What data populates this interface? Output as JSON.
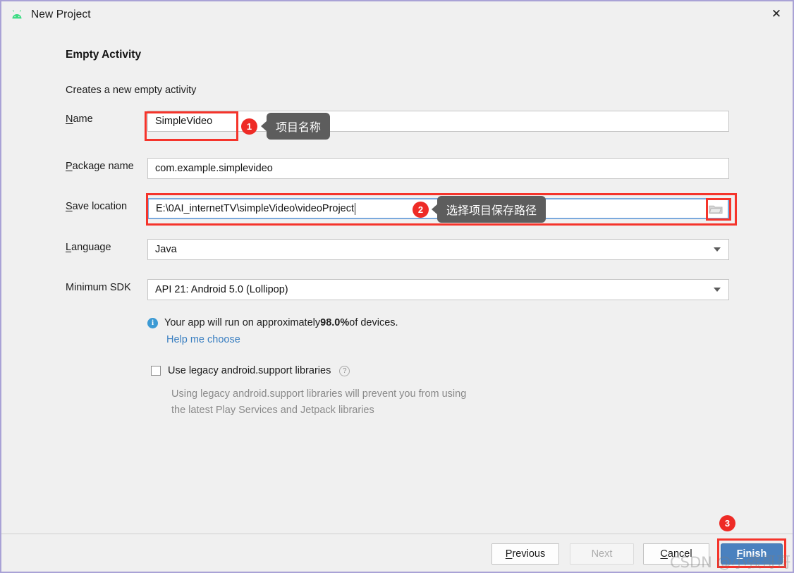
{
  "window": {
    "title": "New Project",
    "app_icon": "android-robot-icon",
    "close_icon": "close-icon",
    "border_color": "#a9a2d6",
    "background": "#f0f0f0"
  },
  "wizard": {
    "heading": "Empty Activity",
    "subheading": "Creates a new empty activity"
  },
  "fields": [
    {
      "label": "Name",
      "mnemonic": "N",
      "rest": "ame",
      "value": "SimpleVideo",
      "type": "text"
    },
    {
      "label": "Package name",
      "mnemonic": "P",
      "rest": "ackage name",
      "value": "com.example.simplevideo",
      "type": "text"
    },
    {
      "label": "Save location",
      "mnemonic": "S",
      "rest": "ave location",
      "value": "E:\\0AI_internetTV\\simpleVideo\\videoProject",
      "type": "text-with-browse",
      "browse_icon": "folder-icon",
      "focused": true
    },
    {
      "label": "Language",
      "mnemonic": "L",
      "rest": "anguage",
      "value": "Java",
      "type": "combo"
    },
    {
      "label": "Minimum SDK",
      "mnemonic": "",
      "rest": "Minimum SDK",
      "value": "API 21: Android 5.0 (Lollipop)",
      "type": "combo"
    }
  ],
  "info": {
    "icon": "info-icon",
    "text_before": "Your app will run on approximately ",
    "percent": "98.0%",
    "text_after": " of devices.",
    "link": "Help me choose",
    "link_color": "#3a7fc1"
  },
  "legacy": {
    "checkbox_label": "Use legacy android.support libraries",
    "checked": false,
    "help_icon": "question-mark-icon",
    "note_line1": "Using legacy android.support libraries will prevent you from using",
    "note_line2": "the latest Play Services and Jetpack libraries"
  },
  "footer": {
    "previous": {
      "mnemonic": "P",
      "rest": "revious"
    },
    "next": {
      "label": "Next",
      "disabled": true
    },
    "cancel": {
      "mnemonic": "C",
      "rest": "ancel"
    },
    "finish": {
      "mnemonic": "F",
      "rest": "inish"
    }
  },
  "annotations": {
    "accent_color": "#f5342b",
    "badge_color": "#ee2b26",
    "callout_bg": "#5d5d5d",
    "badge1": "1",
    "callout1": "项目名称",
    "badge2": "2",
    "callout2": "选择项目保存路径",
    "badge3": "3"
  },
  "watermark": "CSDN @小强哥哥"
}
